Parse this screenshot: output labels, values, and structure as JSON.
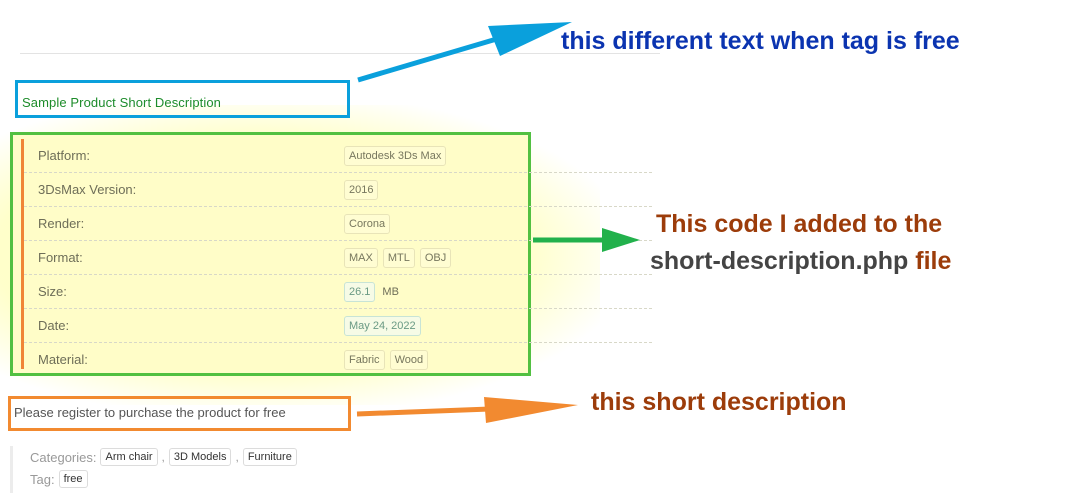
{
  "product": {
    "short_description": "Sample Product Short Description",
    "attributes": [
      {
        "label": "Platform:",
        "values": [
          "Autodesk 3Ds Max"
        ],
        "style": "plain"
      },
      {
        "label": "3DsMax Version:",
        "values": [
          "2016"
        ],
        "style": "plain"
      },
      {
        "label": "Render:",
        "values": [
          "Corona"
        ],
        "style": "plain"
      },
      {
        "label": "Format:",
        "values": [
          "MAX",
          "MTL",
          "OBJ"
        ],
        "style": "plain"
      },
      {
        "label": "Size:",
        "values": [
          "26.1"
        ],
        "unit": "MB",
        "style": "teal"
      },
      {
        "label": "Date:",
        "values": [
          "May 24, 2022"
        ],
        "style": "teal"
      },
      {
        "label": "Material:",
        "values": [
          "Fabric",
          "Wood"
        ],
        "style": "plain"
      }
    ],
    "register_message": "Please register to purchase the product for free",
    "meta": {
      "categories_label": "Categories:",
      "categories": [
        "Arm chair",
        "3D Models",
        "Furniture"
      ],
      "separator": ",",
      "tag_label": "Tag:",
      "tags": [
        "free"
      ]
    }
  },
  "annotations": {
    "different_text": "this different text when tag is free",
    "code_line1": "This code I added to the",
    "code_line2_file": "short-description.php",
    "code_line2_suffix": " file",
    "short_description": "this short description"
  },
  "colors": {
    "blue_annotation": "#0aa0dc",
    "green_annotation": "#52c041",
    "orange_annotation": "#f28a30",
    "highlight": "#fffdc8"
  }
}
